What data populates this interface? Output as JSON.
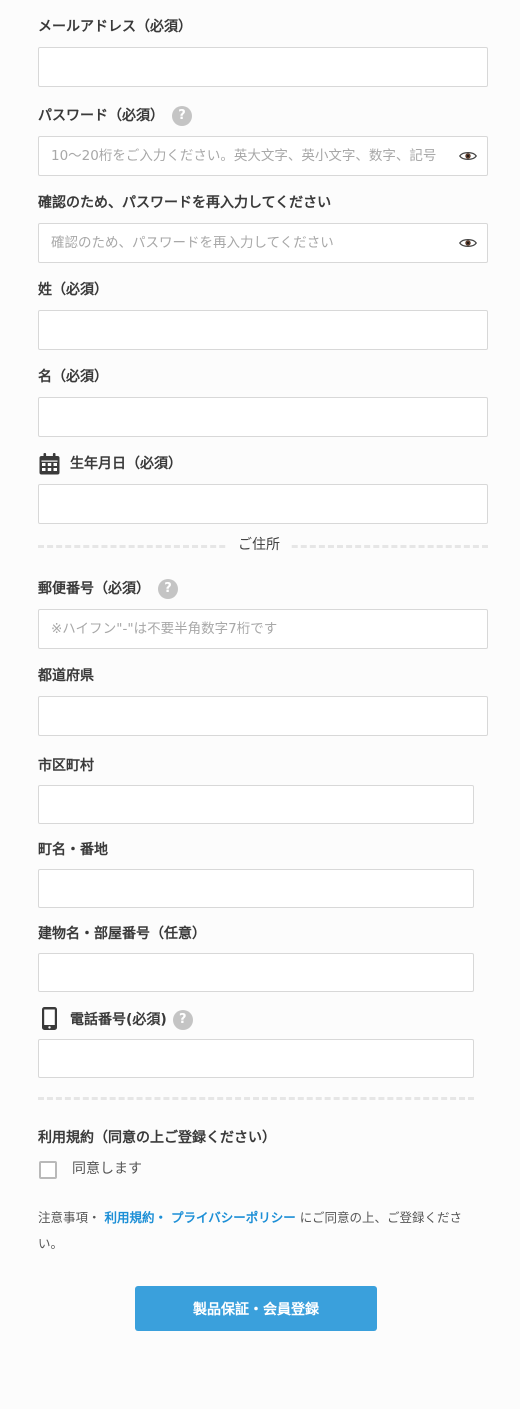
{
  "form": {
    "email_label": "メールアドレス（必須）",
    "password_label": "パスワード（必須）",
    "password_placeholder": "10〜20桁をご入力ください。英大文字、英小文字、数字、記号",
    "confirm_label": "確認のため、パスワードを再入力してください",
    "confirm_placeholder": "確認のため、パスワードを再入力してください",
    "lastname_label": "姓（必須）",
    "firstname_label": "名（必須）",
    "birthday_label": "生年月日（必須）",
    "help_glyph": "?"
  },
  "address": {
    "section_title": "ご住所",
    "postal_label": "郵便番号（必須）",
    "postal_placeholder": "※ハイフン\"-\"は不要半角数字7桁です",
    "prefecture_label": "都道府県",
    "city_label": "市区町村",
    "street_label": "町名・番地",
    "building_label": "建物名・部屋番号（任意）",
    "phone_label": "電話番号(必須)"
  },
  "terms": {
    "heading": "利用規約（同意の上ご登録ください）",
    "agree_label": "同意します",
    "note_prefix": "注意事項・",
    "link_terms": "利用規約・",
    "link_privacy": "プライバシーポリシー",
    "note_suffix": "にご同意の上、ご登録ください。"
  },
  "submit_label": "製品保証・会員登録",
  "colors": {
    "accent": "#3aa0dc",
    "link": "#1d8fd6",
    "help_icon": "#c4c4c4"
  },
  "icons": {
    "birthday": "calendar-icon",
    "phone": "smartphone-icon",
    "password_toggle": "eye-icon"
  }
}
